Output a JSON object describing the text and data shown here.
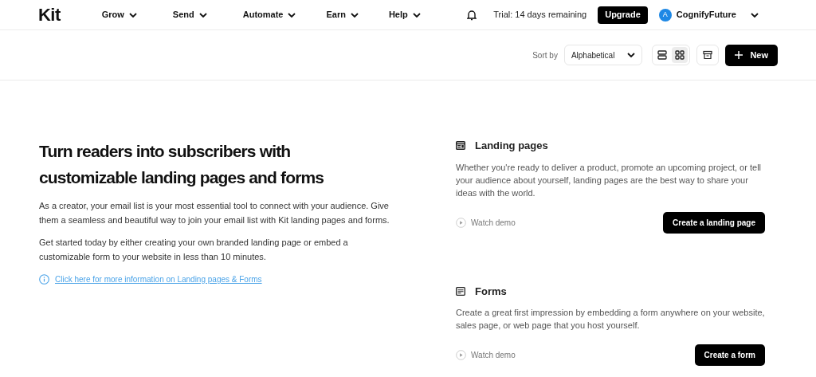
{
  "nav": {
    "logo": "Kit",
    "menus": [
      "Grow",
      "Send",
      "Automate",
      "Earn",
      "Help"
    ],
    "trial": "Trial: 14 days remaining",
    "upgrade": "Upgrade",
    "account": {
      "initial": "A",
      "name": "CognifyFuture"
    }
  },
  "toolbar": {
    "sort_label": "Sort by",
    "sort_value": "Alphabetical",
    "views": [
      {
        "kind": "list",
        "selected": false
      },
      {
        "kind": "grid",
        "selected": true
      }
    ],
    "new_button": "New"
  },
  "intro": {
    "heading": "Turn readers into subscribers with customizable landing pages and forms",
    "paragraphs": [
      "As a creator, your email list is your most essential tool to connect with your audience. Give them a seamless and beautiful way to join your email list with Kit landing pages and forms.",
      "Get started today by either creating your own branded landing page or embed a customizable form to your website in less than 10 minutes."
    ],
    "link": "Click here for more information on Landing pages & Forms"
  },
  "sections": [
    {
      "kind": "landing",
      "title": "Landing pages",
      "description": "Whether you're ready to deliver a product, promote an upcoming project, or tell your audience about yourself, landing pages are the best way to share your ideas with the world.",
      "demo": "Watch demo",
      "action": "Create a landing page"
    },
    {
      "kind": "form",
      "title": "Forms",
      "description": "Create a great first impression by embedding a form anywhere on your website, sales page, or web page that you host yourself.",
      "demo": "Watch demo",
      "action": "Create a form"
    }
  ]
}
